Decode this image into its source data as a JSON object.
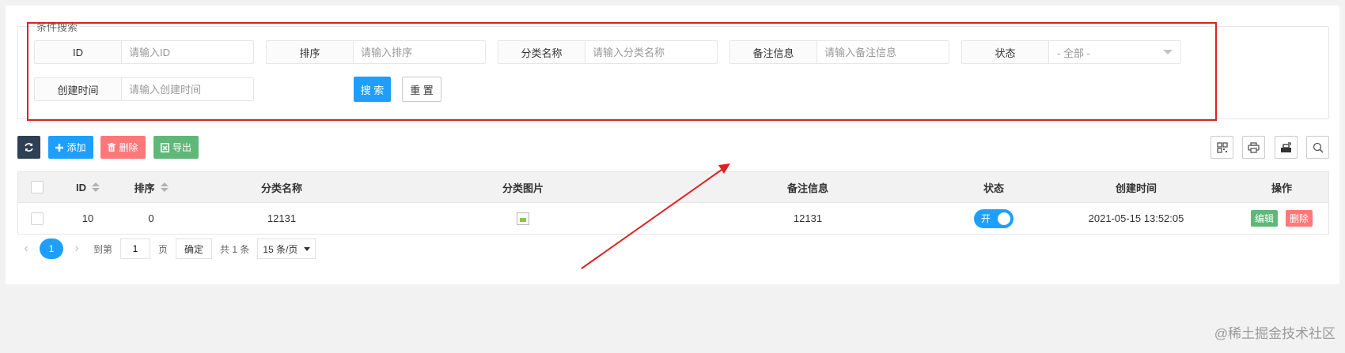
{
  "search": {
    "legend": "条件搜索",
    "fields": [
      {
        "label": "ID",
        "placeholder": "请输入ID"
      },
      {
        "label": "排序",
        "placeholder": "请输入排序"
      },
      {
        "label": "分类名称",
        "placeholder": "请输入分类名称"
      },
      {
        "label": "备注信息",
        "placeholder": "请输入备注信息"
      },
      {
        "label": "状态",
        "select_value": "- 全部 -"
      },
      {
        "label": "创建时间",
        "placeholder": "请输入创建时间"
      }
    ],
    "search_label": "搜 索",
    "reset_label": "重 置"
  },
  "toolbar": {
    "add_label": "添加",
    "delete_label": "删除",
    "export_label": "导出",
    "icons": [
      "refresh-icon",
      "plus-icon",
      "trash-icon",
      "export-icon",
      "columns-icon",
      "print-icon",
      "export-excel-icon",
      "search-icon"
    ]
  },
  "table": {
    "columns": [
      "ID",
      "排序",
      "分类名称",
      "分类图片",
      "备注信息",
      "状态",
      "创建时间",
      "操作"
    ],
    "rows": [
      {
        "id": "10",
        "sort": "0",
        "name": "12131",
        "note": "12131",
        "status": "开",
        "created": "2021-05-15 13:52:05",
        "edit": "编辑",
        "delete": "删除"
      }
    ]
  },
  "pager": {
    "prev": "‹",
    "current": "1",
    "next": "›",
    "goto_label": "到第",
    "goto_value": "1",
    "page_unit": "页",
    "confirm": "确定",
    "total": "共 1 条",
    "page_size": "15 条/页"
  },
  "watermark": "@稀土掘金技术社区",
  "colors": {
    "primary": "#1e9fff",
    "danger": "#ff7878",
    "success": "#5fb878",
    "dark": "#2f4056",
    "annotation": "#e02020"
  }
}
